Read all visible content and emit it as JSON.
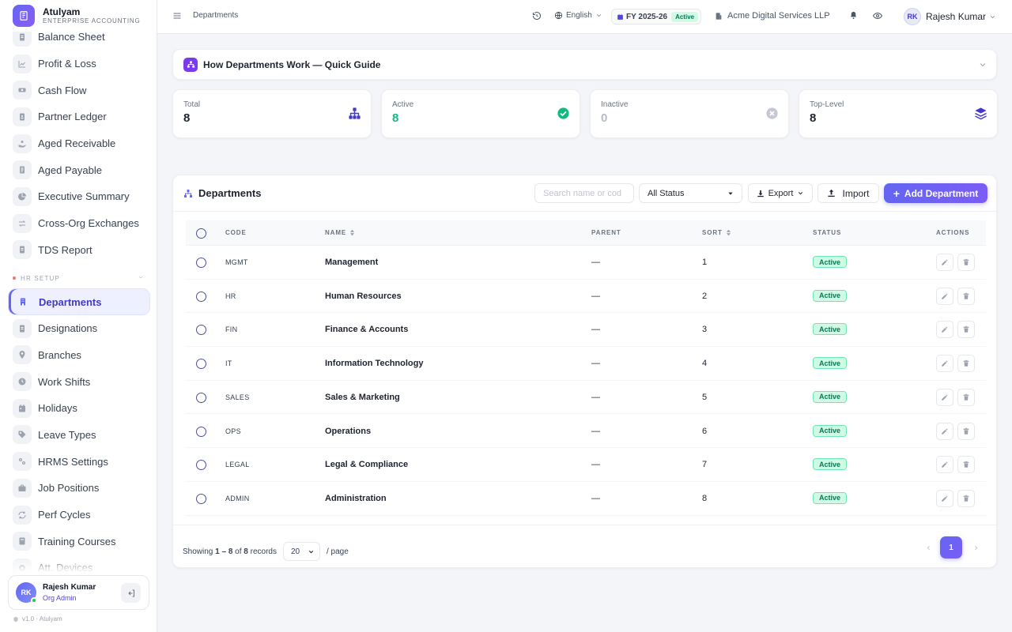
{
  "brand": {
    "name": "Atulyam",
    "subtitle": "ENTERPRISE ACCOUNTING"
  },
  "sidebar": {
    "items_top": [
      {
        "label": "Balance Sheet",
        "icon": "document-icon"
      },
      {
        "label": "Profit & Loss",
        "icon": "chart-line-icon"
      },
      {
        "label": "Cash Flow",
        "icon": "cash-icon"
      },
      {
        "label": "Partner Ledger",
        "icon": "ledger-icon"
      },
      {
        "label": "Aged Receivable",
        "icon": "hand-coin-icon"
      },
      {
        "label": "Aged Payable",
        "icon": "invoice-icon"
      },
      {
        "label": "Executive Summary",
        "icon": "pie-chart-icon"
      },
      {
        "label": "Cross-Org Exchanges",
        "icon": "exchange-icon"
      },
      {
        "label": "TDS Report",
        "icon": "report-icon"
      }
    ],
    "section_label": "HR SETUP",
    "items_hr": [
      {
        "label": "Departments",
        "icon": "building-icon",
        "active": true
      },
      {
        "label": "Designations",
        "icon": "id-card-icon"
      },
      {
        "label": "Branches",
        "icon": "location-pin-icon"
      },
      {
        "label": "Work Shifts",
        "icon": "clock-icon"
      },
      {
        "label": "Holidays",
        "icon": "calendar-icon"
      },
      {
        "label": "Leave Types",
        "icon": "tag-icon"
      },
      {
        "label": "HRMS Settings",
        "icon": "settings-icon"
      },
      {
        "label": "Job Positions",
        "icon": "briefcase-icon"
      },
      {
        "label": "Perf Cycles",
        "icon": "cycle-icon"
      },
      {
        "label": "Training Courses",
        "icon": "book-icon"
      },
      {
        "label": "Att. Devices",
        "icon": "device-icon"
      }
    ],
    "user": {
      "initials": "RK",
      "name": "Rajesh Kumar",
      "role": "Org Admin"
    },
    "version": "v1.0 · Atulyam"
  },
  "topbar": {
    "breadcrumb": "Departments",
    "language": "English",
    "fy_label": "FY 2025-26",
    "fy_status": "Active",
    "org": "Acme Digital Services LLP",
    "user_initials": "RK",
    "user_name": "Rajesh Kumar"
  },
  "guide": {
    "title": "How Departments Work — Quick Guide"
  },
  "stats": [
    {
      "label": "Total",
      "value": "8",
      "color": "#1f2330",
      "icon": "hierarchy-icon"
    },
    {
      "label": "Active",
      "value": "8",
      "color": "#10b981",
      "icon": "check-circle-icon"
    },
    {
      "label": "Inactive",
      "value": "0",
      "color": "#b8bcc6",
      "icon": "x-circle-icon"
    },
    {
      "label": "Top-Level",
      "value": "8",
      "color": "#1f2330",
      "icon": "layers-icon"
    }
  ],
  "table": {
    "title": "Departments",
    "search_placeholder": "Search name or cod",
    "status_filter": "All Status",
    "export_label": "Export",
    "import_label": "Import",
    "add_label": "Add Department",
    "columns": {
      "code": "CODE",
      "name": "NAME",
      "parent": "PARENT",
      "sort": "SORT",
      "status": "STATUS",
      "actions": "ACTIONS"
    },
    "rows": [
      {
        "code": "MGMT",
        "name": "Management",
        "parent": "—",
        "sort": "1",
        "status": "Active"
      },
      {
        "code": "HR",
        "name": "Human Resources",
        "parent": "—",
        "sort": "2",
        "status": "Active"
      },
      {
        "code": "FIN",
        "name": "Finance & Accounts",
        "parent": "—",
        "sort": "3",
        "status": "Active"
      },
      {
        "code": "IT",
        "name": "Information Technology",
        "parent": "—",
        "sort": "4",
        "status": "Active"
      },
      {
        "code": "SALES",
        "name": "Sales & Marketing",
        "parent": "—",
        "sort": "5",
        "status": "Active"
      },
      {
        "code": "OPS",
        "name": "Operations",
        "parent": "—",
        "sort": "6",
        "status": "Active"
      },
      {
        "code": "LEGAL",
        "name": "Legal & Compliance",
        "parent": "—",
        "sort": "7",
        "status": "Active"
      },
      {
        "code": "ADMIN",
        "name": "Administration",
        "parent": "—",
        "sort": "8",
        "status": "Active"
      }
    ]
  },
  "footer": {
    "showing_prefix": "Showing",
    "range": "1 – 8",
    "of": "of",
    "total": "8",
    "records": "records",
    "per_page_value": "20",
    "per_page_suffix": "/ page",
    "current_page": "1"
  }
}
